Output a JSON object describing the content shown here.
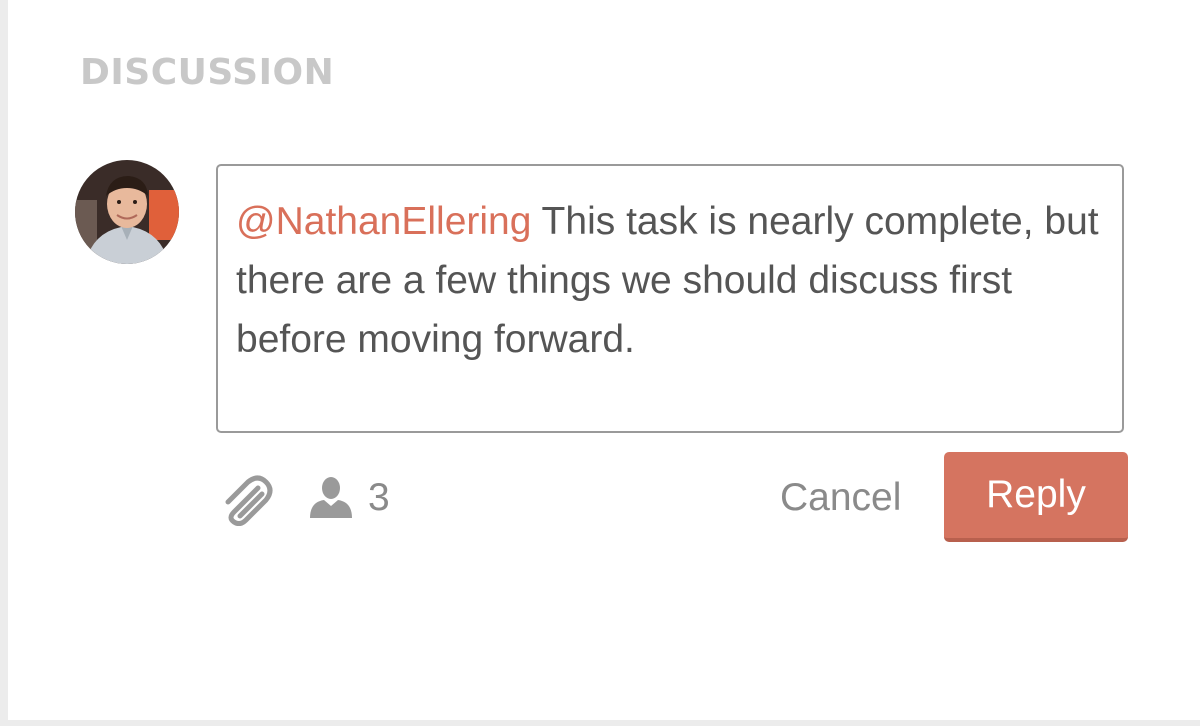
{
  "discussion": {
    "title": "DISCUSSION"
  },
  "comment": {
    "mention": "@NathanEllering",
    "text": " This task is nearly complete, but there are a few things we should discuss first before moving forward."
  },
  "toolbar": {
    "attach_icon": "paperclip-icon",
    "participants_icon": "person-icon",
    "participants_count": "3",
    "cancel_label": "Cancel",
    "reply_label": "Reply"
  },
  "colors": {
    "accent": "#d57460",
    "mention": "#d9705a",
    "text": "#555555",
    "muted": "#8a8a8a",
    "heading": "#c8c8c8"
  }
}
